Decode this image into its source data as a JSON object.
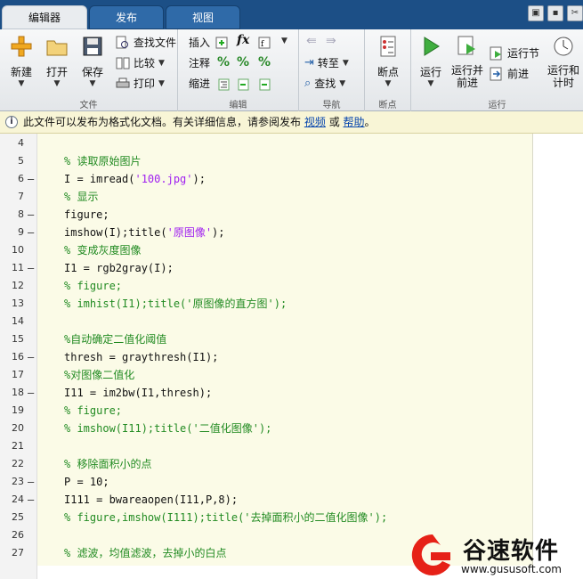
{
  "tabs": [
    {
      "label": "编辑器",
      "active": true
    },
    {
      "label": "发布",
      "active": false
    },
    {
      "label": "视图",
      "active": false
    }
  ],
  "ribbon": {
    "file": {
      "new": "新建",
      "open": "打开",
      "save": "保存",
      "find_file": "查找文件",
      "compare": "比较",
      "print": "打印",
      "group": "文件"
    },
    "edit": {
      "insert": "插入",
      "comment": "注释",
      "indent": "缩进",
      "fx": "fx",
      "group": "编辑"
    },
    "navigate": {
      "goto": "转至",
      "find": "查找",
      "group": "导航"
    },
    "breakpoints": {
      "label": "断点",
      "group": "断点"
    },
    "run": {
      "run": "运行",
      "run_advance": "运行并\n前进",
      "run_section": "运行节",
      "advance": "前进",
      "run_time": "运行和\n计时",
      "group": "运行"
    }
  },
  "infobar": {
    "text": "此文件可以发布为格式化文档。有关详细信息，请参阅发布",
    "link_video": "视频",
    "or": "或",
    "link_help": "帮助",
    "end": "。"
  },
  "code_lines": [
    {
      "n": "4",
      "mark": "",
      "parts": []
    },
    {
      "n": "5",
      "mark": "",
      "parts": [
        {
          "t": "% 读取原始图片",
          "c": "cm"
        }
      ]
    },
    {
      "n": "6",
      "mark": "—",
      "parts": [
        {
          "t": "I = imread(",
          "c": ""
        },
        {
          "t": "'100.jpg'",
          "c": "st"
        },
        {
          "t": ");",
          "c": ""
        }
      ]
    },
    {
      "n": "7",
      "mark": "",
      "parts": [
        {
          "t": "% 显示",
          "c": "cm"
        }
      ]
    },
    {
      "n": "8",
      "mark": "—",
      "parts": [
        {
          "t": "figure;",
          "c": ""
        }
      ]
    },
    {
      "n": "9",
      "mark": "—",
      "parts": [
        {
          "t": "imshow(I);title(",
          "c": ""
        },
        {
          "t": "'原图像'",
          "c": "st"
        },
        {
          "t": ");",
          "c": ""
        }
      ]
    },
    {
      "n": "10",
      "mark": "",
      "parts": [
        {
          "t": "% 变成灰度图像",
          "c": "cm"
        }
      ]
    },
    {
      "n": "11",
      "mark": "—",
      "parts": [
        {
          "t": "I1 = rgb2gray(I);",
          "c": ""
        }
      ]
    },
    {
      "n": "12",
      "mark": "",
      "parts": [
        {
          "t": "% figure;",
          "c": "cm"
        }
      ]
    },
    {
      "n": "13",
      "mark": "",
      "parts": [
        {
          "t": "% imhist(I1);title('原图像的直方图');",
          "c": "cm"
        }
      ]
    },
    {
      "n": "14",
      "mark": "",
      "parts": []
    },
    {
      "n": "15",
      "mark": "",
      "parts": [
        {
          "t": "%自动确定二值化阈值",
          "c": "cm"
        }
      ]
    },
    {
      "n": "16",
      "mark": "—",
      "parts": [
        {
          "t": "thresh = graythresh(I1);",
          "c": ""
        }
      ]
    },
    {
      "n": "17",
      "mark": "",
      "parts": [
        {
          "t": "%对图像二值化",
          "c": "cm"
        }
      ]
    },
    {
      "n": "18",
      "mark": "—",
      "parts": [
        {
          "t": "I11 = im2bw(I1,thresh);",
          "c": ""
        }
      ]
    },
    {
      "n": "19",
      "mark": "",
      "parts": [
        {
          "t": "% figure;",
          "c": "cm"
        }
      ]
    },
    {
      "n": "20",
      "mark": "",
      "parts": [
        {
          "t": "% imshow(I11);title('二值化图像');",
          "c": "cm"
        }
      ]
    },
    {
      "n": "21",
      "mark": "",
      "parts": []
    },
    {
      "n": "22",
      "mark": "",
      "parts": [
        {
          "t": "% 移除面积小的点",
          "c": "cm"
        }
      ]
    },
    {
      "n": "23",
      "mark": "—",
      "parts": [
        {
          "t": "P = 10;",
          "c": ""
        }
      ]
    },
    {
      "n": "24",
      "mark": "—",
      "parts": [
        {
          "t": "I111 = bwareaopen(I11,P,8);",
          "c": ""
        }
      ]
    },
    {
      "n": "25",
      "mark": "",
      "parts": [
        {
          "t": "% figure,imshow(I111);title('去掉面积小的二值化图像');",
          "c": "cm"
        }
      ]
    },
    {
      "n": "26",
      "mark": "",
      "parts": []
    },
    {
      "n": "27",
      "mark": "",
      "parts": [
        {
          "t": "% 滤波，均值滤波，去掉小的白点",
          "c": "cm"
        }
      ]
    }
  ],
  "watermark": {
    "name": "谷速软件",
    "url": "www.gususoft.com"
  },
  "colors": {
    "comment": "#228b22",
    "string": "#a020f0",
    "titlebar": "#1c4f86",
    "info_bg": "#f8f5d6",
    "code_bg": "#fbfbe7"
  }
}
